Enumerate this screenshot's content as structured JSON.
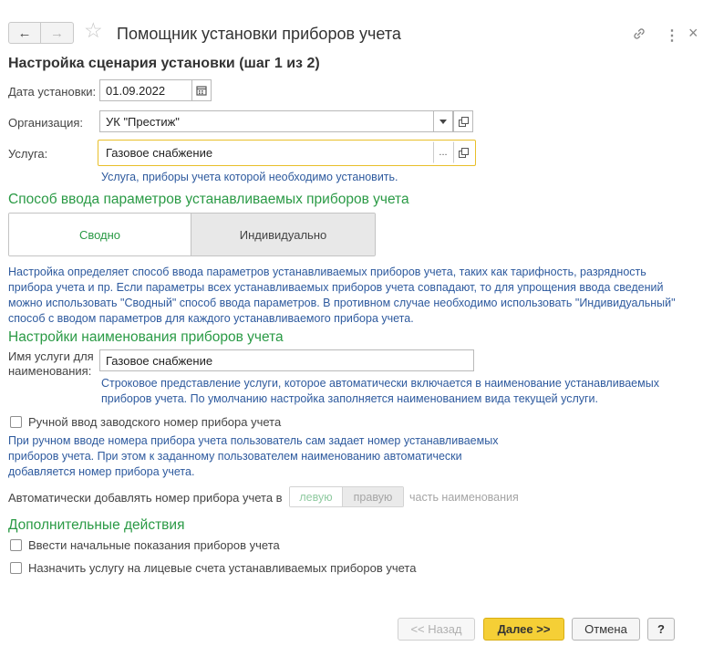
{
  "window": {
    "title": "Помощник установки приборов учета",
    "back_glyph": "←",
    "forward_glyph": "→",
    "star_glyph": "☆",
    "link_glyph": "⛓",
    "more_glyph": "⋮",
    "close_glyph": "×"
  },
  "heading": "Настройка сценария установки (шаг 1 из 2)",
  "install_date": {
    "label": "Дата установки:",
    "value": "01.09.2022"
  },
  "organization": {
    "label": "Организация:",
    "value": "УК \"Престиж\""
  },
  "service": {
    "label": "Услуга:",
    "value": "Газовое снабжение",
    "select_glyph": "...",
    "hint": "Услуга, приборы учета которой необходимо установить."
  },
  "input_method": {
    "title": "Способ ввода параметров устанавливаемых приборов учета",
    "options": [
      "Сводно",
      "Индивидуально"
    ],
    "hint": "Настройка определяет способ ввода параметров устанавливаемых приборов учета, таких как тарифность, разрядность прибора учета и пр. Если параметры всех устанавливаемых приборов учета совпадают, то для упрощения ввода сведений можно использовать \"Сводный\" способ ввода параметров. В противном случае необходимо использовать \"Индивидуальный\" способ с вводом параметров для каждого устанавливаемого прибора учета."
  },
  "naming": {
    "title": "Настройки наименования приборов учета",
    "name_label": "Имя услуги для наименования:",
    "name_value": "Газовое снабжение",
    "name_hint": "Строковое представление услуги, которое автоматически включается в наименование устанавливаемых приборов учета. По умолчанию настройка заполняется наименованием вида текущей услуги.",
    "manual_serial_label": "Ручной ввод заводского номер прибора учета",
    "manual_serial_hint": "При ручном вводе номера прибора учета пользователь сам задает номер устанавливаемых приборов учета. При этом к заданному пользователем наименованию автоматически добавляется номер прибора учета.",
    "auto_add_label": "Автоматически добавлять номер прибора учета в",
    "side_options": [
      "левую",
      "правую"
    ],
    "side_suffix": "часть наименования"
  },
  "extra": {
    "title": "Дополнительные действия",
    "initial_readings_label": "Ввести начальные показания приборов учета",
    "assign_accounts_label": "Назначить услугу на лицевые счета устанавливаемых приборов учета"
  },
  "footer": {
    "back_label": "<< Назад",
    "next_label": "Далее >>",
    "cancel_label": "Отмена",
    "help_label": "?"
  },
  "colors": {
    "section_green": "#2a9a45",
    "hint_blue": "#2e5a9e",
    "primary_yellow": "#f5cf36",
    "focus_border": "#e8bf2a"
  }
}
